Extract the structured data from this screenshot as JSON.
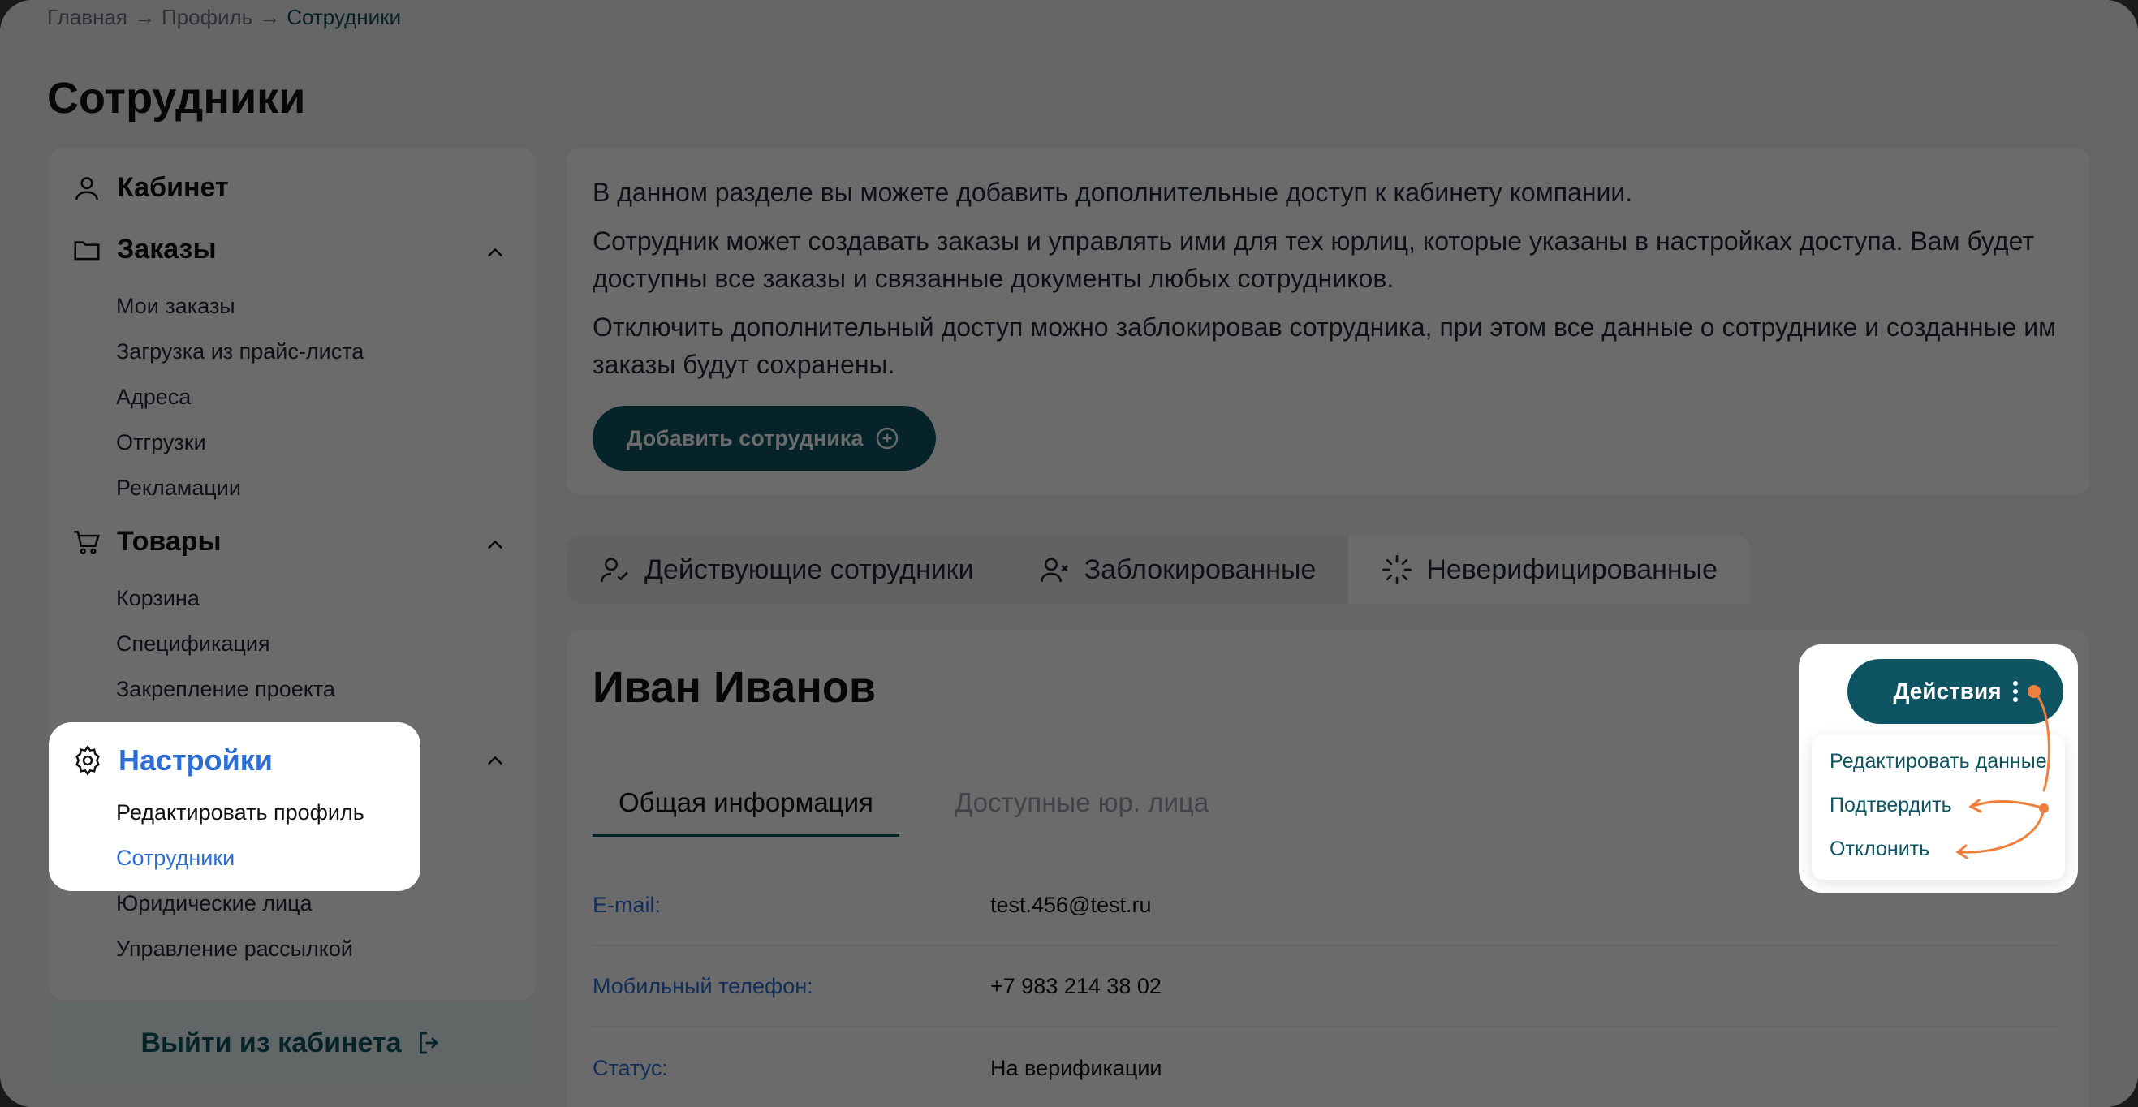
{
  "breadcrumb": [
    "Главная",
    "Профиль",
    "Сотрудники"
  ],
  "breadcrumb_sep": "→",
  "page_title": "Сотрудники",
  "sidebar": {
    "cabinet": "Кабинет",
    "orders": {
      "label": "Заказы",
      "items": [
        "Мои заказы",
        "Загрузка из прайс-листа",
        "Адреса",
        "Отгрузки",
        "Рекламации"
      ]
    },
    "goods": {
      "label": "Товары",
      "items": [
        "Корзина",
        "Спецификация",
        "Закрепление проекта"
      ]
    },
    "settings": {
      "label": "Настройки",
      "items": [
        "Редактировать профиль",
        "Сотрудники",
        "Юридические лица",
        "Управление рассылкой"
      ]
    },
    "logout": "Выйти из кабинета"
  },
  "info": {
    "p1": "В данном разделе вы можете добавить дополнительные доступ к кабинету компании.",
    "p2": "Сотрудник может создавать заказы и управлять ими для тех юрлиц, которые указаны в настройках доступа. Вам будет доступны все заказы и связанные документы любых сотрудников.",
    "p3": "Отключить дополнительный доступ можно заблокировав сотрудника, при этом все данные о сотруднике и созданные им заказы будут сохранены.",
    "add_button": "Добавить сотрудника"
  },
  "tabs": [
    "Действующие сотрудники",
    "Заблокированные",
    "Неверифицированные"
  ],
  "employee": {
    "name": "Иван Иванов",
    "subtabs": [
      "Общая информация",
      "Доступные юр. лица"
    ],
    "fields": [
      {
        "key": "E-mail:",
        "value": "test.456@test.ru"
      },
      {
        "key": "Мобильный телефон:",
        "value": "+7 983 214 38 02"
      },
      {
        "key": "Статус:",
        "value": "На верификации"
      }
    ]
  },
  "actions": {
    "button": "Действия",
    "menu": [
      "Редактировать данные",
      "Подтвердить",
      "Отклонить"
    ]
  },
  "colors": {
    "accent": "#0f5463",
    "link": "#2d6ed6",
    "annotation": "#f07f3c"
  }
}
